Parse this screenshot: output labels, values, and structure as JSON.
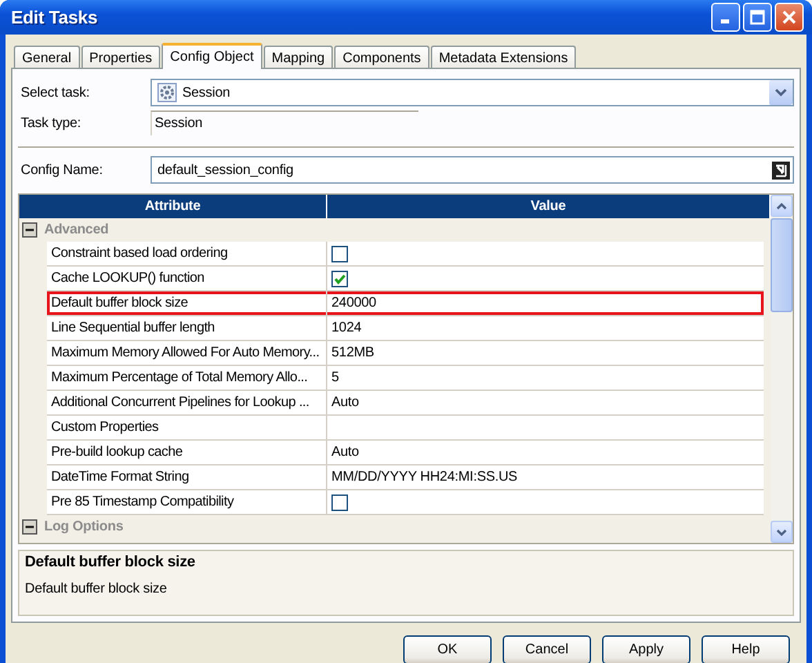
{
  "window": {
    "title": "Edit Tasks"
  },
  "tabs": [
    {
      "label": "General",
      "selected": false
    },
    {
      "label": "Properties",
      "selected": false
    },
    {
      "label": "Config Object",
      "selected": true
    },
    {
      "label": "Mapping",
      "selected": false
    },
    {
      "label": "Components",
      "selected": false
    },
    {
      "label": "Metadata Extensions",
      "selected": false
    }
  ],
  "select_task": {
    "label": "Select task:",
    "value": "Session"
  },
  "task_type": {
    "label": "Task type:",
    "value": "Session"
  },
  "config_name": {
    "label": "Config Name:",
    "value": "default_session_config"
  },
  "grid": {
    "columns": [
      "Attribute",
      "Value"
    ],
    "groups": [
      {
        "name": "Advanced",
        "expanded": true,
        "rows": [
          {
            "attribute": "Constraint based load ordering",
            "kind": "checkbox",
            "checked": false,
            "selected": false
          },
          {
            "attribute": "Cache LOOKUP() function",
            "kind": "checkbox",
            "checked": true,
            "selected": false
          },
          {
            "attribute": "Default buffer block size",
            "kind": "text",
            "value": "240000",
            "selected": true
          },
          {
            "attribute": "Line Sequential buffer length",
            "kind": "text",
            "value": "1024",
            "selected": false
          },
          {
            "attribute": "Maximum Memory Allowed For Auto Memory...",
            "kind": "text",
            "value": "512MB",
            "selected": false
          },
          {
            "attribute": "Maximum Percentage of Total Memory Allo...",
            "kind": "text",
            "value": "5",
            "selected": false
          },
          {
            "attribute": "Additional Concurrent Pipelines for Lookup ...",
            "kind": "text",
            "value": "Auto",
            "selected": false
          },
          {
            "attribute": "Custom Properties",
            "kind": "text",
            "selected": false
          },
          {
            "attribute": "Pre-build lookup cache",
            "kind": "text",
            "value": "Auto",
            "selected": false
          },
          {
            "attribute": "DateTime Format String",
            "kind": "text",
            "value": "MM/DD/YYYY HH24:MI:SS.US",
            "selected": false
          },
          {
            "attribute": "Pre 85 Timestamp Compatibility",
            "kind": "checkbox",
            "checked": false,
            "selected": false
          }
        ]
      },
      {
        "name": "Log Options",
        "expanded": true
      }
    ]
  },
  "description": {
    "title": "Default buffer block size",
    "text": "Default buffer block size"
  },
  "buttons": [
    "OK",
    "Cancel",
    "Apply",
    "Help"
  ]
}
